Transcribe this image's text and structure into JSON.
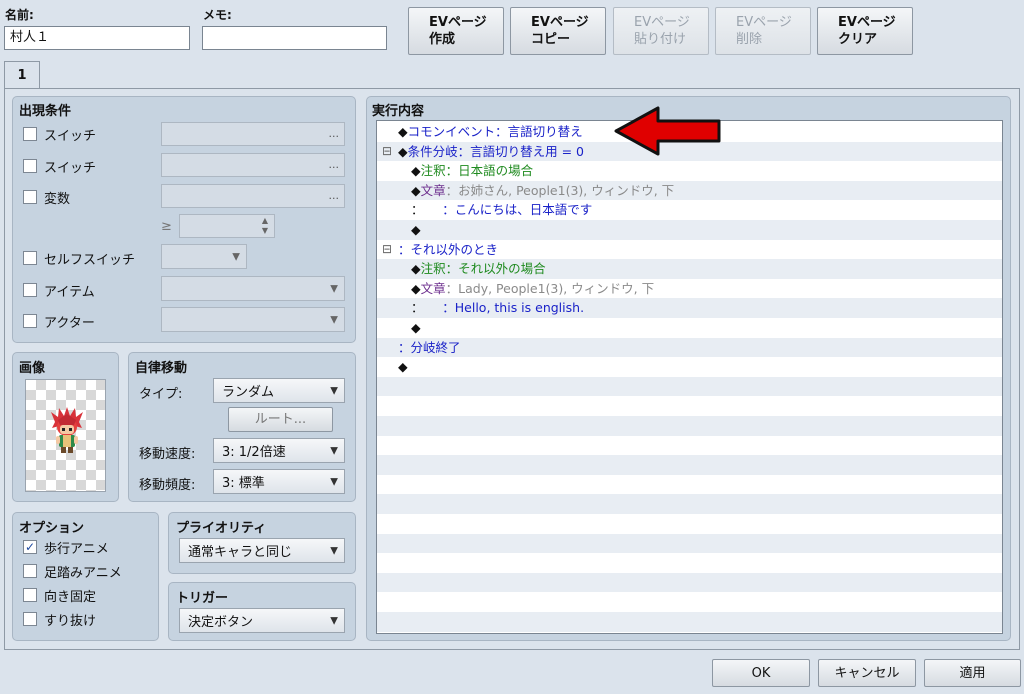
{
  "header": {
    "name_label": "名前:",
    "name_value": "村人１",
    "memo_label": "メモ:",
    "memo_value": "",
    "toolbar": [
      {
        "line1": "EVページ",
        "line2": "作成",
        "enabled": true
      },
      {
        "line1": "EVページ",
        "line2": "コピー",
        "enabled": true
      },
      {
        "line1": "EVページ",
        "line2": "貼り付け",
        "enabled": false
      },
      {
        "line1": "EVページ",
        "line2": "削除",
        "enabled": false
      },
      {
        "line1": "EVページ",
        "line2": "クリア",
        "enabled": true
      }
    ]
  },
  "tabs": [
    {
      "label": "1",
      "active": true
    }
  ],
  "conditions": {
    "title": "出現条件",
    "switch1": {
      "label": "スイッチ",
      "checked": false,
      "value": "..."
    },
    "switch2": {
      "label": "スイッチ",
      "checked": false,
      "value": "..."
    },
    "variable": {
      "label": "変数",
      "checked": false,
      "value": "..."
    },
    "compare_symbol": "≥",
    "self_switch": {
      "label": "セルフスイッチ",
      "checked": false
    },
    "item": {
      "label": "アイテム",
      "checked": false
    },
    "actor": {
      "label": "アクター",
      "checked": false
    }
  },
  "image": {
    "title": "画像"
  },
  "autonomous": {
    "title": "自律移動",
    "type_label": "タイプ:",
    "type_value": "ランダム",
    "route_button": "ルート...",
    "speed_label": "移動速度:",
    "speed_value": "3: 1/2倍速",
    "freq_label": "移動頻度:",
    "freq_value": "3: 標準"
  },
  "options": {
    "title": "オプション",
    "items": [
      {
        "label": "歩行アニメ",
        "checked": true
      },
      {
        "label": "足踏みアニメ",
        "checked": false
      },
      {
        "label": "向き固定",
        "checked": false
      },
      {
        "label": "すり抜け",
        "checked": false
      }
    ]
  },
  "priority": {
    "title": "プライオリティ",
    "value": "通常キャラと同じ"
  },
  "trigger": {
    "title": "トリガー",
    "value": "決定ボタン"
  },
  "contents": {
    "title": "実行内容",
    "rows": [
      {
        "toggle": "",
        "indent": 1,
        "parts": [
          [
            "◆",
            "black"
          ],
          [
            "コモンイベント：言語切り替え",
            "blue"
          ]
        ]
      },
      {
        "toggle": "⊟",
        "indent": 1,
        "parts": [
          [
            "◆",
            "black"
          ],
          [
            "条件分岐：言語切り替え用 = 0",
            "blue"
          ]
        ]
      },
      {
        "toggle": "",
        "indent": 2,
        "parts": [
          [
            "◆",
            "black"
          ],
          [
            "注釈：日本語の場合",
            "green"
          ]
        ]
      },
      {
        "toggle": "",
        "indent": 2,
        "parts": [
          [
            "◆",
            "black"
          ],
          [
            "文章",
            "purple"
          ],
          [
            "：お姉さん, People1(3), ウィンドウ, 下",
            "gray"
          ]
        ]
      },
      {
        "toggle": "",
        "indent": 2,
        "parts": [
          [
            "：",
            "black"
          ],
          [
            "　　：こんにちは、日本語です",
            "blue"
          ]
        ]
      },
      {
        "toggle": "",
        "indent": 2,
        "parts": [
          [
            "◆",
            "black"
          ]
        ]
      },
      {
        "toggle": "⊟",
        "indent": 1,
        "parts": [
          [
            "：それ以外のとき",
            "blue"
          ]
        ]
      },
      {
        "toggle": "",
        "indent": 2,
        "parts": [
          [
            "◆",
            "black"
          ],
          [
            "注釈：それ以外の場合",
            "green"
          ]
        ]
      },
      {
        "toggle": "",
        "indent": 2,
        "parts": [
          [
            "◆",
            "black"
          ],
          [
            "文章",
            "purple"
          ],
          [
            "：Lady, People1(3), ウィンドウ, 下",
            "gray"
          ]
        ]
      },
      {
        "toggle": "",
        "indent": 2,
        "parts": [
          [
            "：",
            "black"
          ],
          [
            "　　：Hello, this is english.",
            "blue"
          ]
        ]
      },
      {
        "toggle": "",
        "indent": 2,
        "parts": [
          [
            "◆",
            "black"
          ]
        ]
      },
      {
        "toggle": "",
        "indent": 1,
        "parts": [
          [
            "：分岐終了",
            "blue"
          ]
        ]
      },
      {
        "toggle": "",
        "indent": 1,
        "parts": [
          [
            "◆",
            "black"
          ]
        ]
      }
    ],
    "total_rows": 26
  },
  "footer": {
    "ok": "OK",
    "cancel": "キャンセル",
    "apply": "適用"
  },
  "colors": {
    "annotation_arrow": "#e00000",
    "text_blue": "#1a22c8",
    "text_green": "#1e8a1e",
    "text_purple": "#6b2c8c"
  }
}
